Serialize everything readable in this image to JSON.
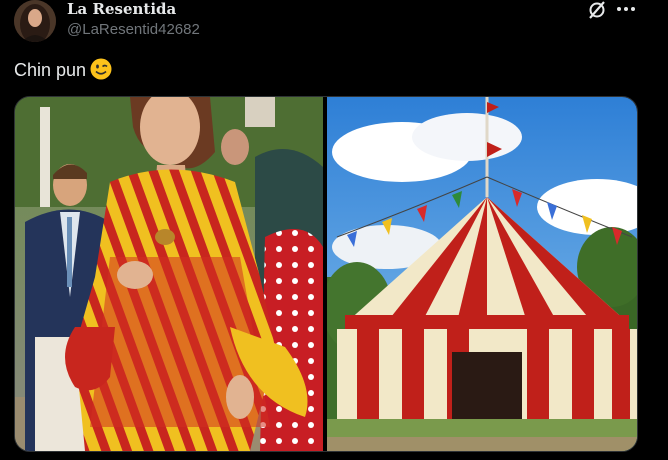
{
  "author": {
    "display_name": "La Resentida",
    "handle": "@LaResentid42682",
    "avatar_icon": "avatar-photo"
  },
  "header_actions": {
    "grok_icon": "grok-icon",
    "more_icon": "more-dots-icon"
  },
  "tweet": {
    "text": "Chin pun",
    "emoji": "winking-face-emoji"
  },
  "media": {
    "images": [
      {
        "name": "woman-flamenco-dress-photo",
        "colors": [
          "#f0c020",
          "#c8261e"
        ]
      },
      {
        "name": "circus-tent-photo",
        "colors": [
          "#f2e8c8",
          "#c0201a",
          "#3a8fd8"
        ]
      }
    ]
  }
}
